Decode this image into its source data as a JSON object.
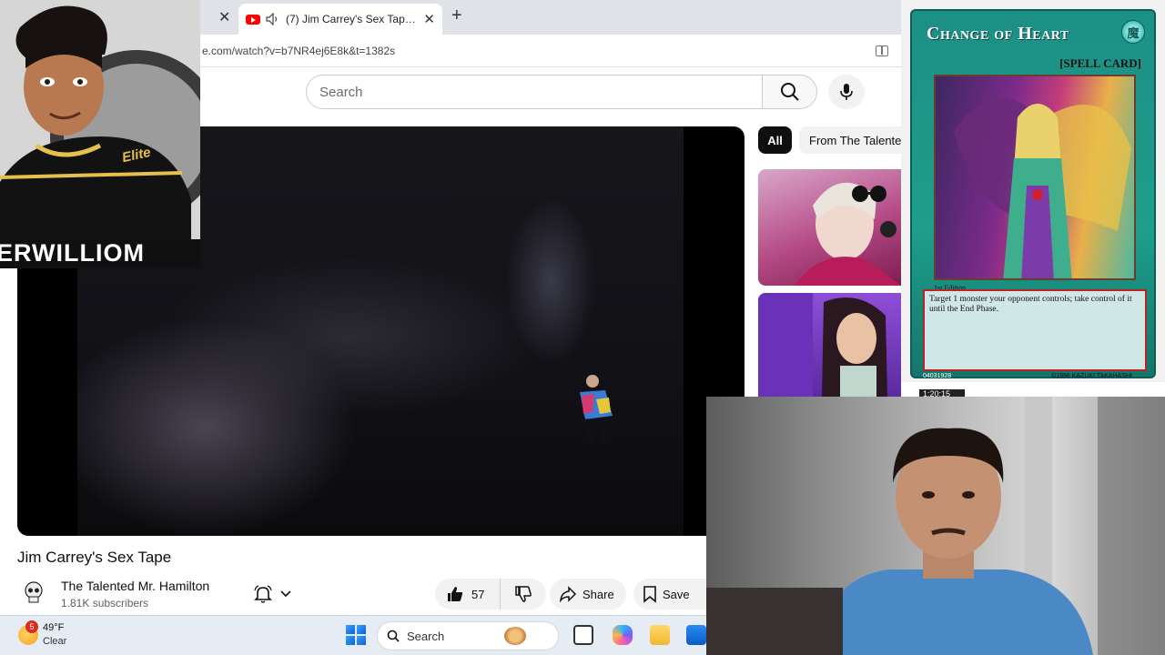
{
  "browser": {
    "active_tab_title": "(7) Jim Carrey's Sex Tape - YouTube",
    "url": "e.com/watch?v=b7NR4ej6E8k&t=1382s"
  },
  "youtube": {
    "search_placeholder": "Search",
    "video_title": "Jim Carrey's Sex Tape",
    "channel_name": "The Talented Mr. Hamilton",
    "subscribers": "1.81K subscribers",
    "like_count": "57",
    "share_label": "Share",
    "save_label": "Save",
    "chips": [
      "All",
      "From The Talente"
    ],
    "thumb_time": "1:20:15"
  },
  "card": {
    "name": "Change of Heart",
    "type": "[SPELL CARD]",
    "edition": "1st Edition",
    "text": "Target 1 monster your opponent controls; take control of it until the End Phase.",
    "id": "04031928",
    "copyright": "©1996 KAZUKI TAKAHASHI"
  },
  "logo": {
    "badge_text": "Elite",
    "bottom_text": "ERWILLIOM"
  },
  "taskbar": {
    "notification_count": "5",
    "temperature": "49°F",
    "condition": "Clear",
    "search_label": "Search"
  },
  "colors": {
    "accent": "#ff0000",
    "card_teal": "#1e9e8b"
  }
}
